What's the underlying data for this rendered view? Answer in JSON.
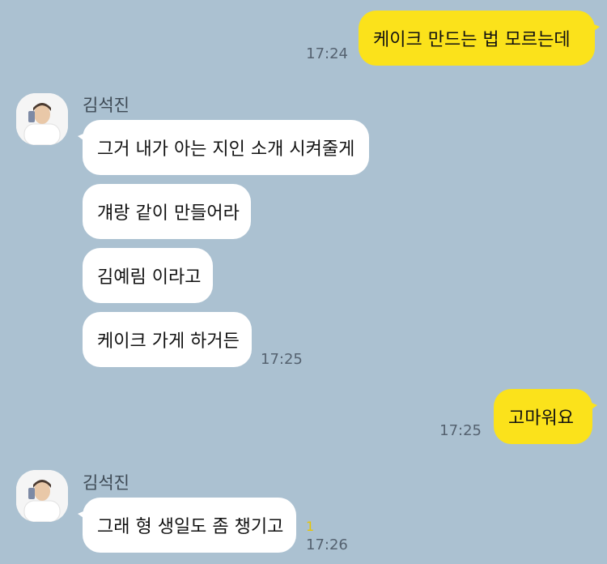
{
  "colors": {
    "background": "#abc1d1",
    "my_bubble": "#fbe21b",
    "their_bubble": "#ffffff",
    "unread": "#e8c500"
  },
  "messages": [
    {
      "sender": "me",
      "text": "케이크 만드는 법 모르는데",
      "time": "17:24"
    },
    {
      "sender": "김석진",
      "text": "그거 내가 아는 지인 소개 시켜줄게"
    },
    {
      "sender": "김석진",
      "text": "걔랑 같이 만들어라"
    },
    {
      "sender": "김석진",
      "text": "김예림 이라고"
    },
    {
      "sender": "김석진",
      "text": "케이크 가게 하거든",
      "time": "17:25"
    },
    {
      "sender": "me",
      "text": "고마워요",
      "time": "17:25"
    },
    {
      "sender": "김석진",
      "text": "그래 형 생일도 좀 챙기고",
      "time": "17:26",
      "unread": "1"
    }
  ],
  "group1": {
    "name": "김석진"
  },
  "group2": {
    "name": "김석진"
  }
}
